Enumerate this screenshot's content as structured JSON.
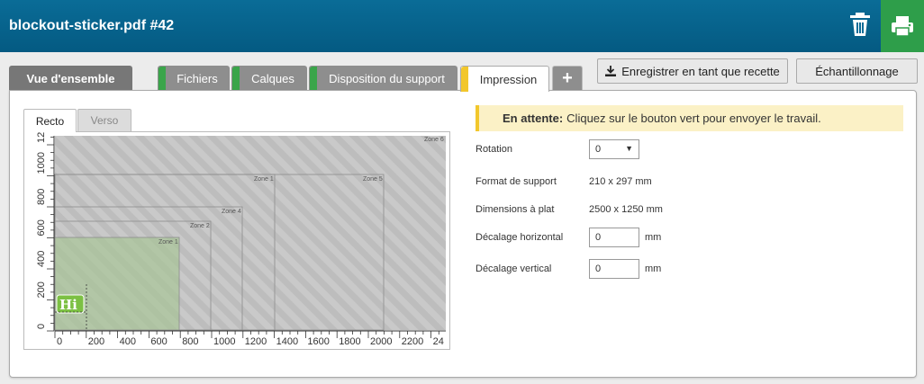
{
  "header": {
    "title": "blockout-sticker.pdf #42"
  },
  "tabs": [
    {
      "label": "Vue d'ensemble"
    },
    {
      "label": "Fichiers"
    },
    {
      "label": "Calques"
    },
    {
      "label": "Disposition du support"
    },
    {
      "label": "Impression"
    },
    {
      "label": "+"
    }
  ],
  "actions": {
    "save_recipe": "Enregistrer en tant que recette",
    "sampling": "Échantillonnage"
  },
  "preview": {
    "side_tabs": [
      "Recto",
      "Verso"
    ],
    "zones": [
      "Zone 1",
      "Zone 2",
      "Zone 3",
      "Zone 4",
      "Zone 5",
      "Zone 6"
    ],
    "x_ticks": [
      "0",
      "200",
      "400",
      "600",
      "800",
      "1000",
      "1200",
      "1400",
      "1600",
      "1800",
      "2000",
      "2200",
      "24"
    ],
    "y_ticks": [
      "0",
      "200",
      "400",
      "600",
      "800",
      "1000",
      "1200"
    ],
    "sticker_text": "Hi"
  },
  "notice": {
    "strong": "En attente:",
    "text": "Cliquez sur le bouton vert pour envoyer le travail."
  },
  "form": {
    "rotation_label": "Rotation",
    "rotation_value": "0",
    "media_format_label": "Format de support",
    "media_format_value": "210 x 297 mm",
    "flat_dims_label": "Dimensions à plat",
    "flat_dims_value": "2500 x 1250 mm",
    "h_offset_label": "Décalage horizontal",
    "h_offset_value": "0",
    "v_offset_label": "Décalage vertical",
    "v_offset_value": "0",
    "unit": "mm"
  },
  "colors": {
    "header": "#045a82",
    "print_button": "#2e9e4a",
    "done_tab": "#3aa54a",
    "active_tab": "#f2c72c",
    "notice_bg": "#fbf1c6"
  }
}
